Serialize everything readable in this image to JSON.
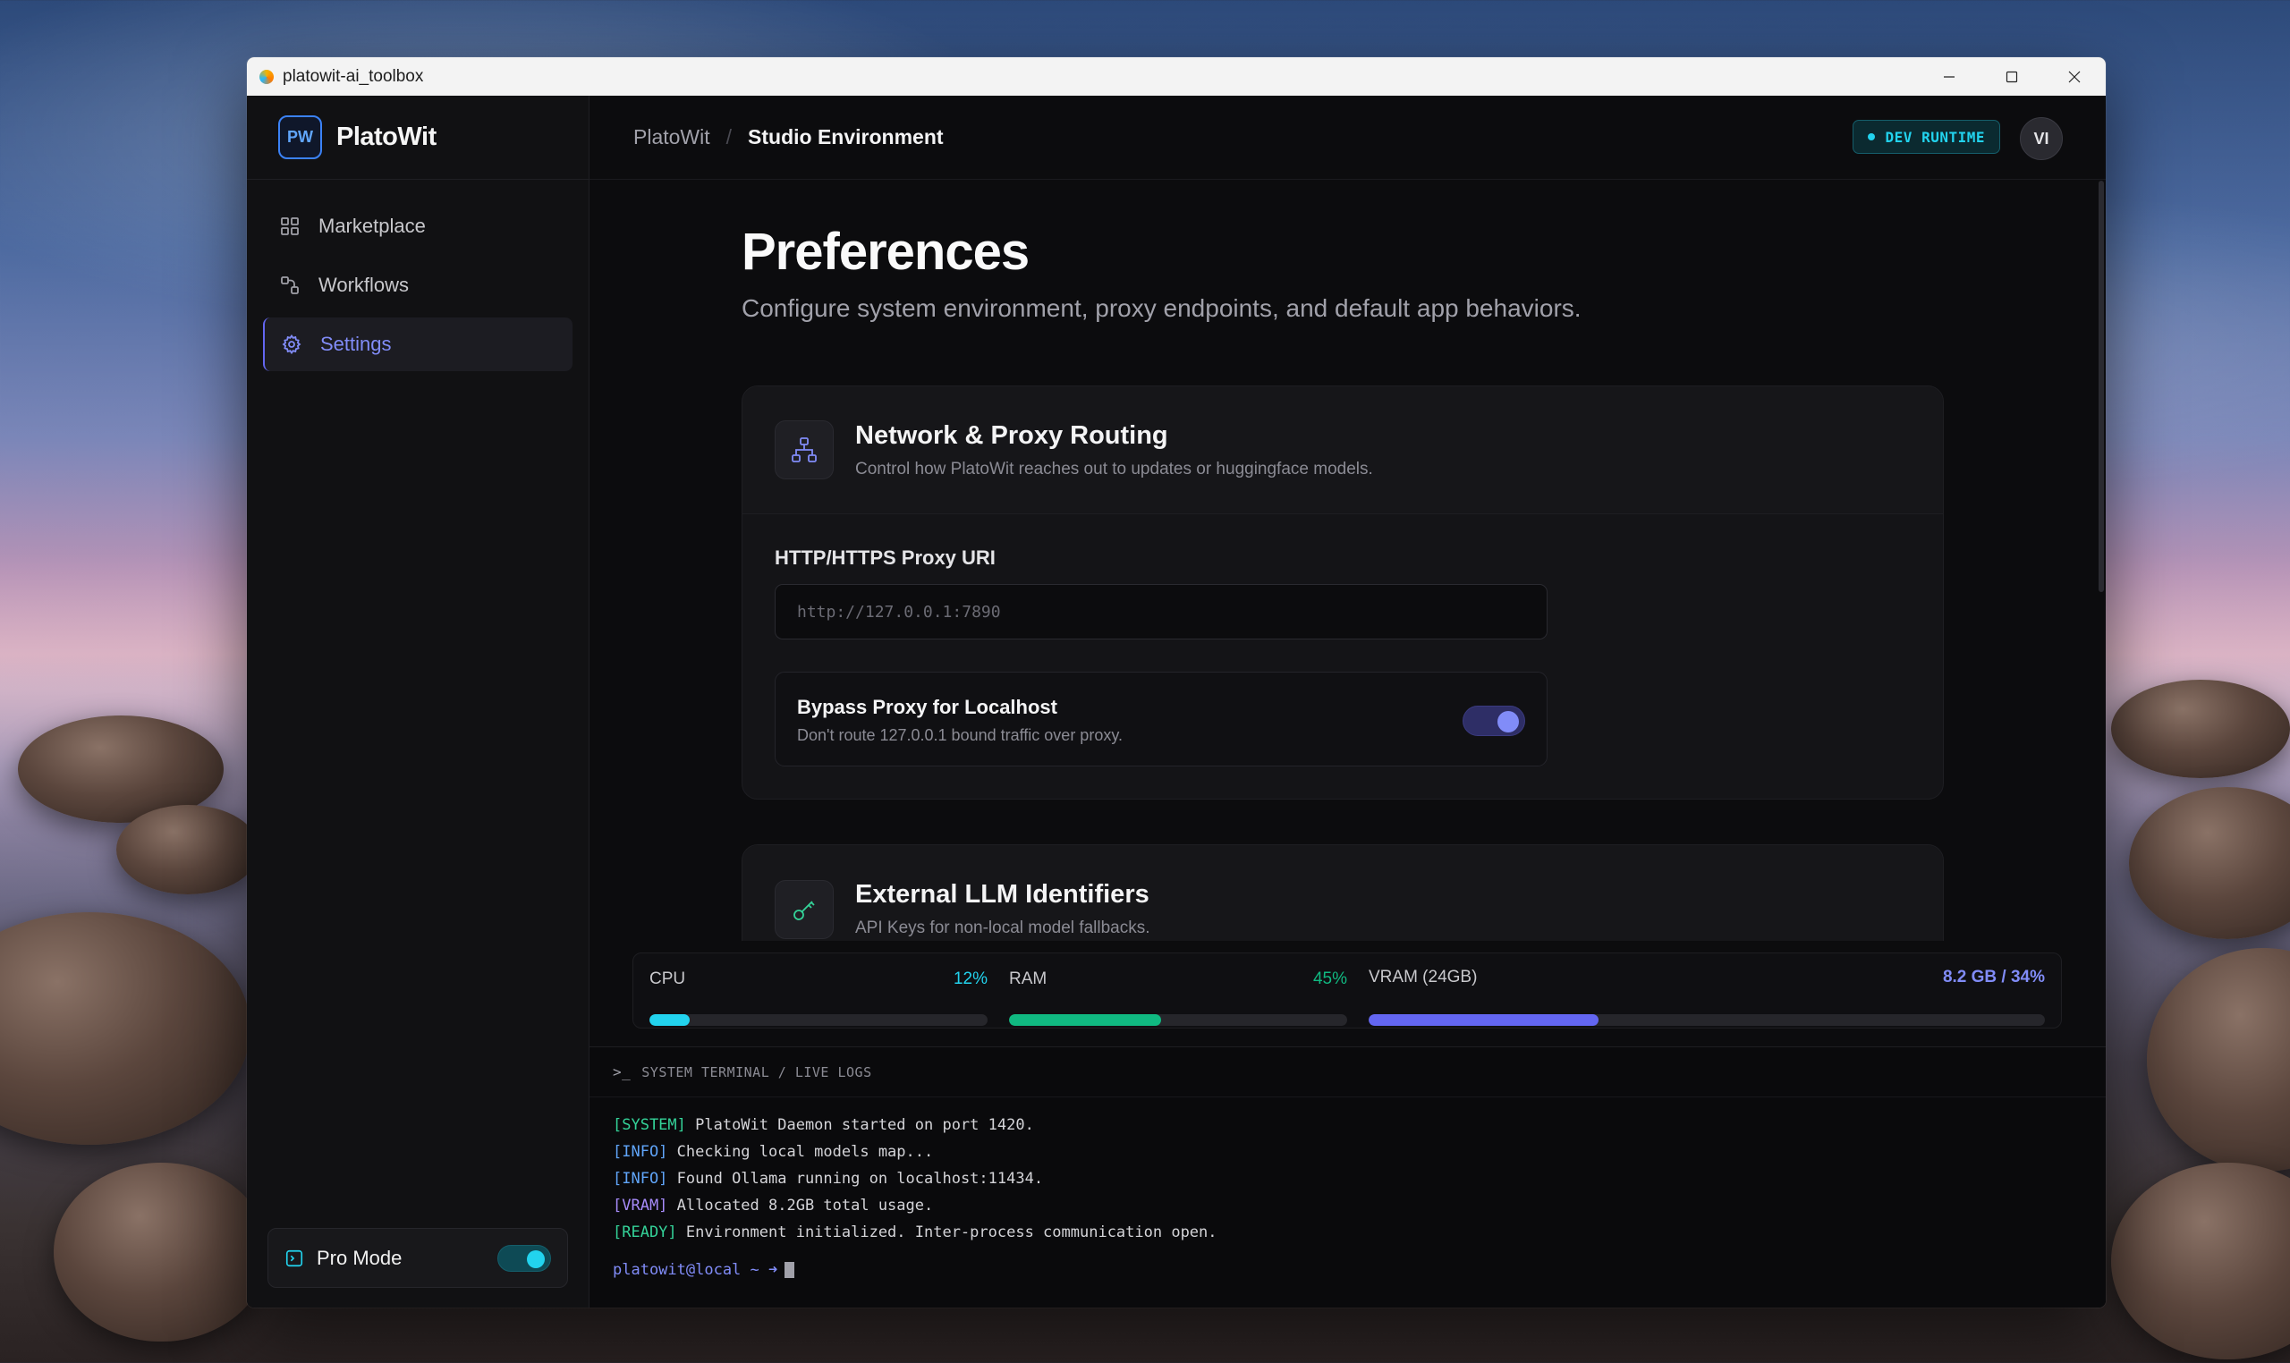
{
  "window": {
    "title": "platowit-ai_toolbox"
  },
  "brand": {
    "logo_text": "PW",
    "name": "PlatoWit"
  },
  "sidebar": {
    "items": [
      {
        "label": "Marketplace",
        "icon": "grid-icon"
      },
      {
        "label": "Workflows",
        "icon": "workflow-icon"
      },
      {
        "label": "Settings",
        "icon": "gear-icon",
        "active": true
      }
    ],
    "pro_mode": {
      "label": "Pro Mode",
      "enabled": true
    }
  },
  "header": {
    "breadcrumb_root": "PlatoWit",
    "breadcrumb_sep": "/",
    "breadcrumb_current": "Studio Environment",
    "runtime_badge": "DEV RUNTIME",
    "avatar": "VI"
  },
  "page": {
    "title": "Preferences",
    "subtitle": "Configure system environment, proxy endpoints, and default app behaviors."
  },
  "network_card": {
    "title": "Network & Proxy Routing",
    "subtitle": "Control how PlatoWit reaches out to updates or huggingface models.",
    "proxy_label": "HTTP/HTTPS Proxy URI",
    "proxy_placeholder": "http://127.0.0.1:7890",
    "proxy_value": "",
    "bypass": {
      "title": "Bypass Proxy for Localhost",
      "subtitle": "Don't route 127.0.0.1 bound traffic over proxy.",
      "enabled": true
    }
  },
  "llm_card": {
    "title": "External LLM Identifiers",
    "subtitle": "API Keys for non-local model fallbacks."
  },
  "stats": {
    "cpu": {
      "label": "CPU",
      "value": "12%",
      "fraction": 0.12,
      "color": "#22d3ee"
    },
    "ram": {
      "label": "RAM",
      "value": "45%",
      "fraction": 0.45,
      "color": "#10b981"
    },
    "vram": {
      "label": "VRAM (24GB)",
      "value": "8.2 GB / 34%",
      "fraction": 0.34,
      "color": "#6366f1"
    }
  },
  "terminal": {
    "header": "SYSTEM TERMINAL / LIVE LOGS",
    "lines": [
      {
        "tag": "[SYSTEM]",
        "text": " PlatoWit Daemon started on port 1420."
      },
      {
        "tag": "[INFO]",
        "text": " Checking local models map..."
      },
      {
        "tag": "[INFO]",
        "text": " Found Ollama running on localhost:11434."
      },
      {
        "tag": "[VRAM]",
        "text": " Allocated 8.2GB total usage."
      },
      {
        "tag": "[READY]",
        "text": " Environment initialized. Inter-process communication open."
      }
    ],
    "prompt": "platowit@local ~ ➜"
  }
}
